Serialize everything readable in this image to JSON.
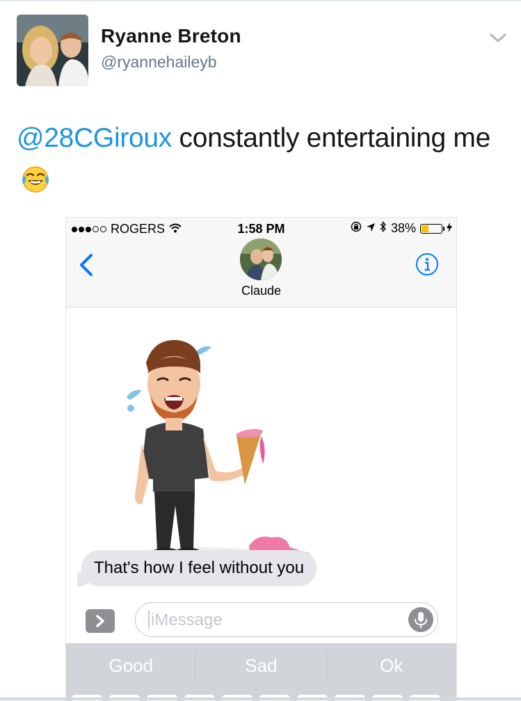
{
  "tweet": {
    "display_name": "Ryanne Breton",
    "handle": "@ryannehaileyb",
    "mention": "@28CGiroux",
    "text_after_mention": " constantly entertaining me",
    "emoji": "face-with-tears-of-joy-icon"
  },
  "phone": {
    "status_bar": {
      "carrier": "ROGERS",
      "time": "1:58 PM",
      "battery_percent": "38%",
      "battery_level": 0.38
    },
    "header": {
      "contact_name": "Claude"
    },
    "message": {
      "text": "That's how I feel without you"
    },
    "compose": {
      "placeholder": "iMessage"
    },
    "quicktype": [
      "Good",
      "Sad",
      "Ok"
    ]
  },
  "colors": {
    "link": "#1b95e0",
    "bubble": "#e5e5ea",
    "ios_blue": "#007aff",
    "battery": "#f5c400"
  }
}
